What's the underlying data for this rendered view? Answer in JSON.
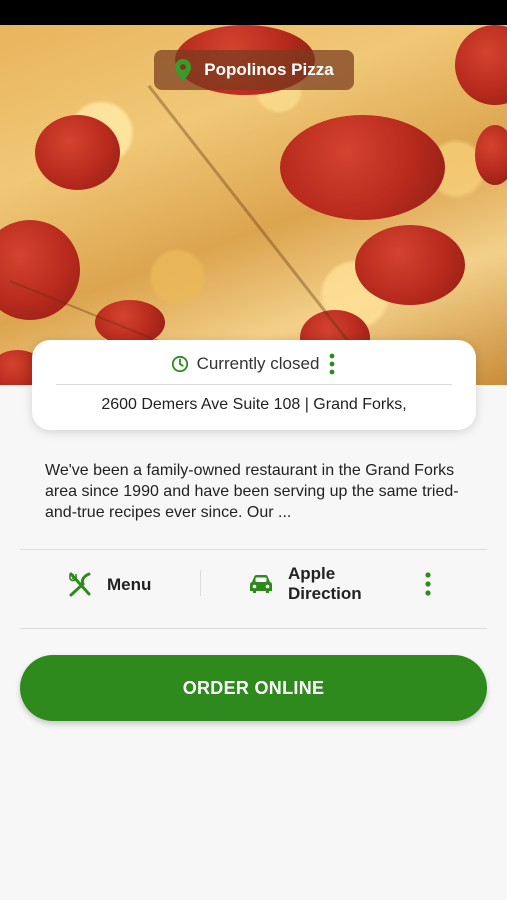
{
  "restaurant": {
    "name": "Popolinos Pizza"
  },
  "status": {
    "text": "Currently closed"
  },
  "address": "2600 Demers Ave Suite 108 | Grand Forks,",
  "description": "We've been a family-owned restaurant in the Grand Forks area since 1990 and have been serving up the same tried-and-true recipes ever since. Our ...",
  "actions": {
    "menu_label": "Menu",
    "direction_label_1": "Apple",
    "direction_label_2": "Direction"
  },
  "order_button": {
    "label": "ORDER ONLINE"
  },
  "colors": {
    "accent": "#2e8a1d",
    "background": "#f7f7f7"
  },
  "icons": [
    "map-pin-icon",
    "clock-icon",
    "more-vertical-icon",
    "utensils-icon",
    "car-icon"
  ]
}
